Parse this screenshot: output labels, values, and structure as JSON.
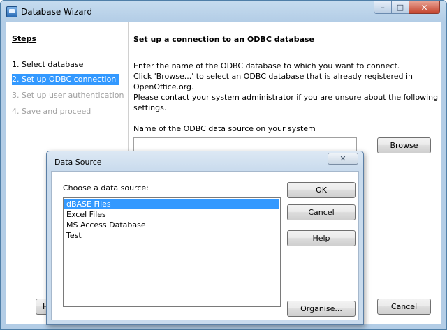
{
  "window": {
    "title": "Database Wizard",
    "minimize": "–",
    "maximize": "□",
    "close": "✕"
  },
  "steps": {
    "title": "Steps",
    "items": [
      {
        "label": "1. Select database",
        "state": "done"
      },
      {
        "label": "2. Set up ODBC connection",
        "state": "current"
      },
      {
        "label": "3. Set up user authentication",
        "state": "disabled"
      },
      {
        "label": "4. Save and proceed",
        "state": "disabled"
      }
    ]
  },
  "main": {
    "page_title": "Set up a connection to an ODBC database",
    "description_lines": [
      "Enter the name of the ODBC database to which you want to connect.",
      "Click 'Browse...' to select an ODBC database that is already registered in",
      "OpenOffice.org.",
      "Please contact your system administrator if you are unsure about the following",
      "settings."
    ],
    "field_label": "Name of the ODBC data source on your system",
    "field_value": "",
    "browse_label": "Browse",
    "help_label": "He",
    "cancel_label": "Cancel"
  },
  "dialog": {
    "title": "Data Source",
    "close": "✕",
    "choose_label": "Choose a data source:",
    "items": [
      "dBASE Files",
      "Excel Files",
      "MS Access Database",
      "Test"
    ],
    "selected": "dBASE Files",
    "ok_label": "OK",
    "cancel_label": "Cancel",
    "help_label": "Help",
    "organise_label": "Organise..."
  },
  "colors": {
    "selection": "#3399ff",
    "title_gradient_top": "#c6dcef",
    "title_gradient_bottom": "#b3cde6",
    "close_button": "#c4432c"
  }
}
